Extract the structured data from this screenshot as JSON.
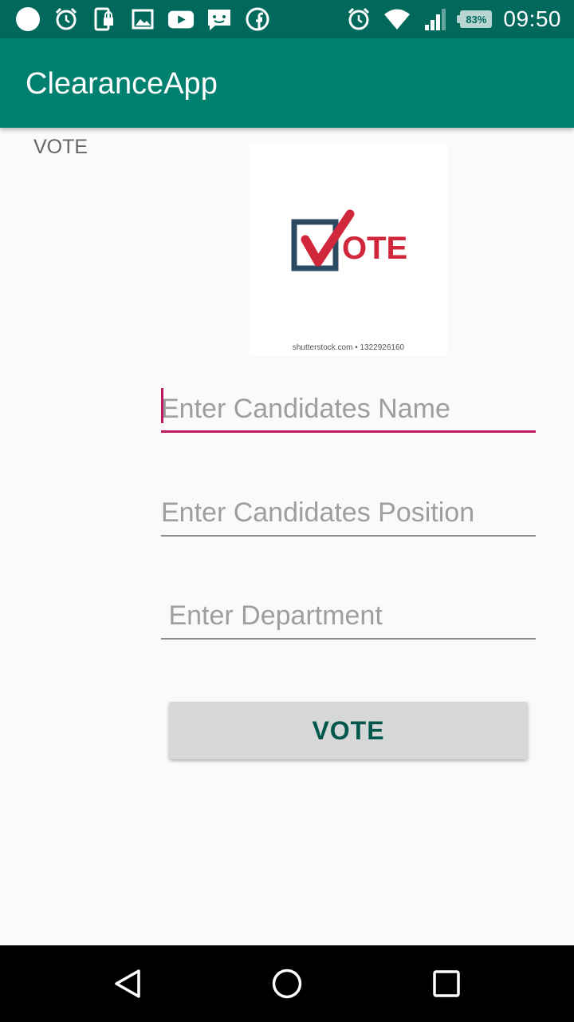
{
  "status_bar": {
    "time": "09:50",
    "battery": "83%",
    "left_icons": [
      "circle-icon",
      "alarm-icon",
      "device-lock-icon",
      "image-icon",
      "youtube-icon",
      "message-icon",
      "facebook-icon"
    ],
    "right_icons": [
      "alarm-icon",
      "wifi-icon",
      "signal-icon",
      "battery-icon"
    ]
  },
  "app_bar": {
    "title": "ClearanceApp"
  },
  "main": {
    "label": "VOTE",
    "logo": {
      "text": "OTE",
      "watermark": "shutterstock.com • 1322926160"
    },
    "fields": {
      "name": {
        "placeholder": "Enter Candidates Name",
        "value": ""
      },
      "position": {
        "placeholder": "Enter Candidates Position",
        "value": ""
      },
      "department": {
        "placeholder": " Enter Department",
        "value": ""
      }
    },
    "button": {
      "label": "VOTE"
    }
  },
  "nav_bar": {
    "icons": [
      "back-icon",
      "home-icon",
      "recents-icon"
    ]
  },
  "colors": {
    "status_bar": "#00695c",
    "app_bar": "#00806e",
    "accent": "#c2185b",
    "button_text": "#00574b"
  }
}
